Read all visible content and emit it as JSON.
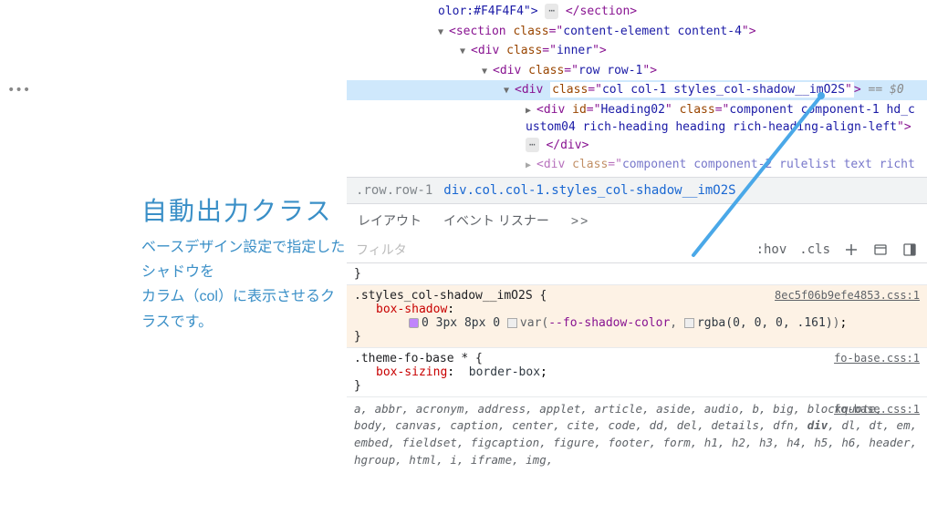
{
  "annotation": {
    "title": "自動出力クラス",
    "desc_line1": "ベースデザイン設定で指定したシャドウを",
    "desc_line2": "カラム（col）に表示させるクラスです。"
  },
  "dom": {
    "line0_text": "olor:#F4F4F4\">",
    "line0_close": "</section>",
    "section_class": "content-element content-4",
    "inner_class": "inner",
    "row_class": "row row-1",
    "selected_div_class": "col col-1 styles_col-shadow__imO2S",
    "eq0": " == $0",
    "heading_id": "Heading02",
    "heading_class_wrap": "component component-1 hd_custom04 rich-heading heading rich-heading-align-left",
    "heading_close": "</div>",
    "next_div_class": "component component-2 rulelist text richt"
  },
  "breadcrumb": {
    "item1": ".row.row-1",
    "selected": "div.col.col-1.styles_col-shadow__imO2S"
  },
  "tabs": {
    "layout": "レイアウト",
    "event": "イベント リスナー",
    "more": ">>"
  },
  "toolbar": {
    "filter": "フィルタ",
    "hov": ":hov",
    "cls": ".cls"
  },
  "styles": {
    "plain_brace": "}",
    "rule1_selector": ".styles_col-shadow__imO2S {",
    "rule1_src": "8ec5f06b9efe4853.css:1",
    "rule1_prop": "box-shadow",
    "rule1_val_prefix": "0 3px 8px 0 ",
    "rule1_var": "--fo-shadow-color",
    "rule1_fallback": "rgba(0, 0, 0, .161)",
    "rule2_selector": ".theme-fo-base * {",
    "rule2_src": "fo-base.css:1",
    "rule2_prop": "box-sizing",
    "rule2_val": "border-box",
    "ua_src": "fo-base.css:1",
    "ua_tags_l1": "a, abbr, acronym, address, applet, article, aside, audio, b, big, blockquote, body, canvas, caption, center, cite, code, dd, del, details, dfn, ",
    "ua_div": "div",
    "ua_tags_l2": ", dl, dt, em, embed, fieldset, figcaption, figure, footer, form, h1, h2, h3, h4, h5, h6, header, hgroup, html, i, iframe, img,"
  }
}
